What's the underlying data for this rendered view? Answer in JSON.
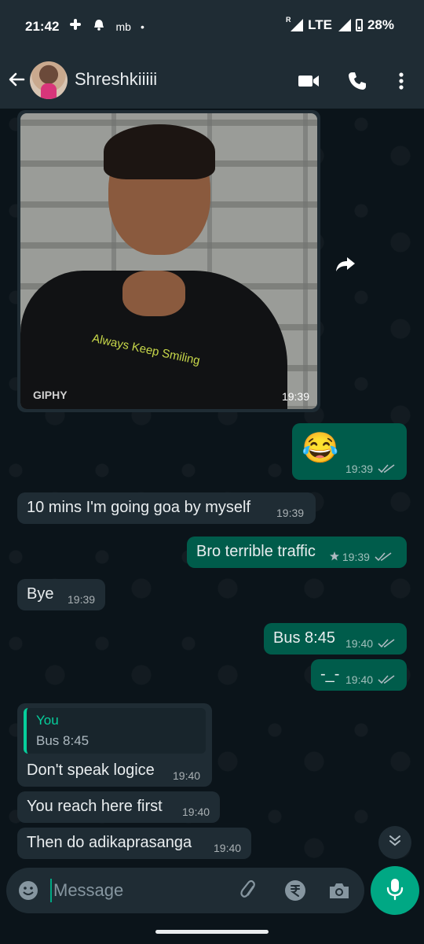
{
  "status_bar": {
    "time": "21:42",
    "carrier_label": "mb",
    "dot": "•",
    "network": "LTE",
    "battery": "28%",
    "roaming": "R"
  },
  "header": {
    "back_icon": "arrow-left-icon",
    "contact_name": "Shreshkiiiii",
    "video_icon": "video-camera-icon",
    "call_icon": "phone-icon",
    "menu_icon": "more-vertical-icon"
  },
  "messages": {
    "gif": {
      "watermark": "GIPHY",
      "shirt_text": "Always Keep Smiling",
      "time": "19:39"
    },
    "m1": {
      "text": "😂",
      "time": "19:39",
      "direction": "out",
      "ticks": "read"
    },
    "m2": {
      "text": "10 mins I'm going goa by myself",
      "time": "19:39",
      "direction": "in"
    },
    "m3": {
      "text": "Bro terrible traffic",
      "time": "19:39",
      "direction": "out",
      "starred": true,
      "ticks": "read"
    },
    "m4": {
      "text": "Bye",
      "time": "19:39",
      "direction": "in"
    },
    "m5": {
      "text": "Bus 8:45",
      "time": "19:40",
      "direction": "out",
      "ticks": "read"
    },
    "m6": {
      "text": "-_-",
      "time": "19:40",
      "direction": "out",
      "ticks": "read"
    },
    "m7": {
      "quote_author": "You",
      "quote_text": "Bus 8:45",
      "text": "Don't speak logice",
      "time": "19:40",
      "direction": "in"
    },
    "m8": {
      "text": "You reach here first",
      "time": "19:40",
      "direction": "in"
    },
    "m9": {
      "text": "Then do adikaprasanga",
      "time": "19:40",
      "direction": "in"
    }
  },
  "composer": {
    "placeholder": "Message",
    "emoji_icon": "emoji-icon",
    "attach_icon": "paperclip-icon",
    "payment_icon": "rupee-icon",
    "camera_icon": "camera-icon",
    "mic_icon": "microphone-icon"
  },
  "colors": {
    "background": "#0b141a",
    "header": "#1f2c34",
    "incoming_bubble": "#1f2c34",
    "outgoing_bubble": "#005c4b",
    "accent": "#00a884",
    "read_ticks": "#53bdeb"
  }
}
